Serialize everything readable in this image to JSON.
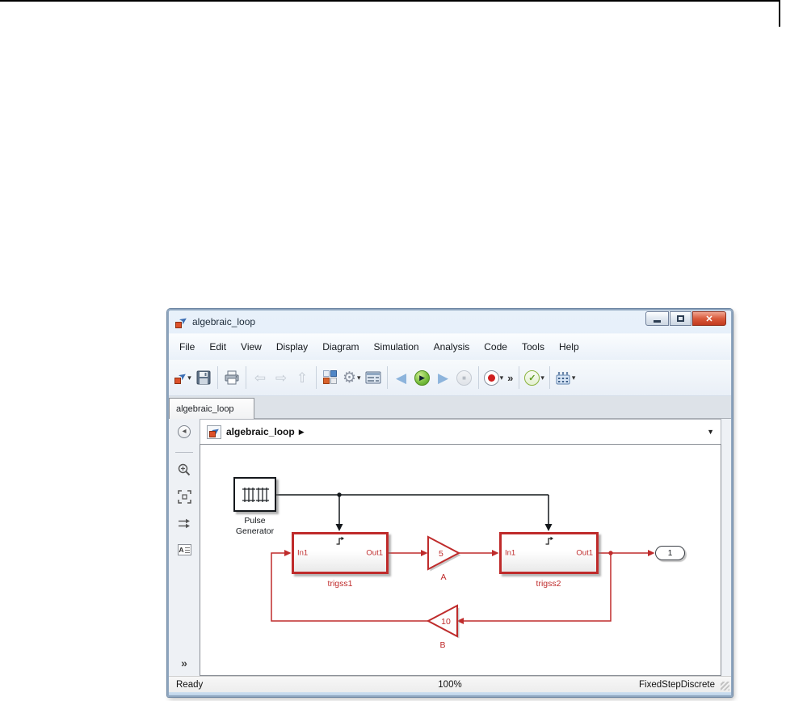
{
  "window": {
    "title": "algebraic_loop",
    "controls": {
      "close_glyph": "✕"
    },
    "menu_items": [
      "File",
      "Edit",
      "View",
      "Display",
      "Diagram",
      "Simulation",
      "Analysis",
      "Code",
      "Tools",
      "Help"
    ],
    "toolbar": {
      "back_glyph": "⇦",
      "forward_glyph": "⇨",
      "up_glyph": "⇧",
      "gear_glyph": "⚙",
      "step_back_glyph": "◀",
      "run_glyph": "▶",
      "step_forward_glyph": "▶",
      "stop_glyph": "■",
      "check_glyph": "✓",
      "caret_glyph": "▾",
      "overflow_glyph": "»"
    },
    "tab_label": "algebraic_loop",
    "breadcrumb": {
      "model": "algebraic_loop",
      "separator_glyph": "▶",
      "dropdown_glyph": "▼"
    },
    "palette": {
      "explorer_glyph": "◂",
      "annotation_text": "A",
      "more_glyph": "»"
    },
    "status": {
      "state": "Ready",
      "zoom": "100%",
      "solver": "FixedStepDiscrete"
    }
  },
  "diagram": {
    "pulse_generator": {
      "label_line1": "Pulse",
      "label_line2": "Generator"
    },
    "subsystem1": {
      "name": "trigss1",
      "in": "In1",
      "out": "Out1"
    },
    "subsystem2": {
      "name": "trigss2",
      "in": "In1",
      "out": "Out1"
    },
    "gain_a": {
      "value": "5",
      "label": "A"
    },
    "gain_b": {
      "value": "10",
      "label": "B"
    },
    "outport": {
      "value": "1"
    },
    "colors": {
      "highlight_red": "#bf2b2b",
      "line_black": "#14181c"
    }
  }
}
